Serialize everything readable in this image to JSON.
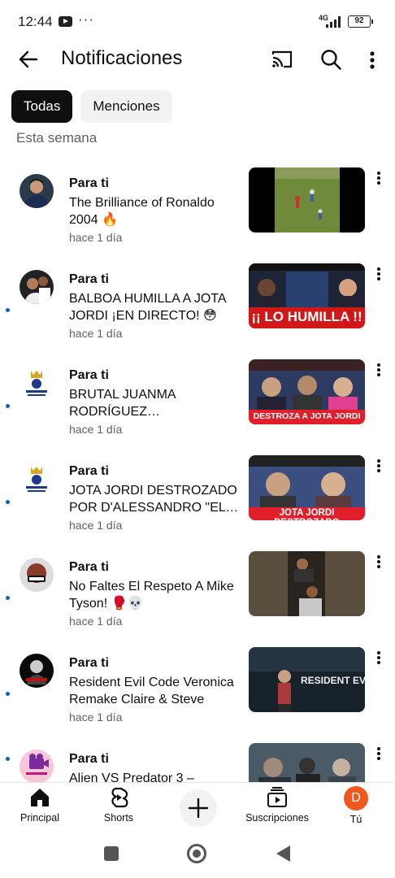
{
  "status_bar": {
    "time": "12:44",
    "dots": "···",
    "network": "4G",
    "battery": "92"
  },
  "header": {
    "title": "Notificaciones",
    "icons": [
      "back-arrow-icon",
      "cast-icon",
      "search-icon",
      "more-vert-icon"
    ]
  },
  "chips": [
    {
      "label": "Todas",
      "selected": true
    },
    {
      "label": "Menciones",
      "selected": false
    }
  ],
  "section_label": "Esta semana",
  "notifications": [
    {
      "label": "Para ti",
      "title": "The Brilliance of Ronaldo 2004 🔥",
      "time": "hace 1 día",
      "unread": false,
      "thumb_text": ""
    },
    {
      "label": "Para ti",
      "title": "BALBOA HUMILLA A JOTA JORDI ¡EN DIRECTO! 😳",
      "time": "hace 1 día",
      "unread": true,
      "thumb_text": "¡¡ LO HUMILLA !!"
    },
    {
      "label": "Para ti",
      "title": "BRUTAL JUANMA RODRÍGUEZ DESTROZANDO A JOTA JORDI",
      "time": "hace 1 día",
      "unread": true,
      "thumb_text": "DESTROZA A JOTA JORDI"
    },
    {
      "label": "Para ti",
      "title": "JOTA JORDI DESTROZADO POR D'ALESSANDRO \"EL MADRID ESTÁ POR ENCIMA\"",
      "time": "hace 1 día",
      "unread": true,
      "thumb_text": "JOTA JORDI DESTROZADO"
    },
    {
      "label": "Para ti",
      "title": "No Faltes El Respeto A Mike Tyson! 🥊💀",
      "time": "hace 1 día",
      "unread": true,
      "thumb_text": ""
    },
    {
      "label": "Para ti",
      "title": "Resident Evil Code Veronica Remake Claire & Steve",
      "time": "hace 1 día",
      "unread": true,
      "thumb_text": "RESIDENT EVIL"
    },
    {
      "label": "Para ti",
      "title": "Alien VS Predator 3 –",
      "time": "",
      "unread": true,
      "thumb_text": ""
    }
  ],
  "bottom_nav": {
    "principal": "Principal",
    "shorts": "Shorts",
    "subscriptions": "Suscripciones",
    "you": "Tú",
    "avatar_letter": "D",
    "avatar_color": "#f1581f"
  },
  "colors": {
    "accent_blue": "#065fd4",
    "chip_active": "#0f0f0f",
    "chip_inactive": "#f2f2f2"
  }
}
